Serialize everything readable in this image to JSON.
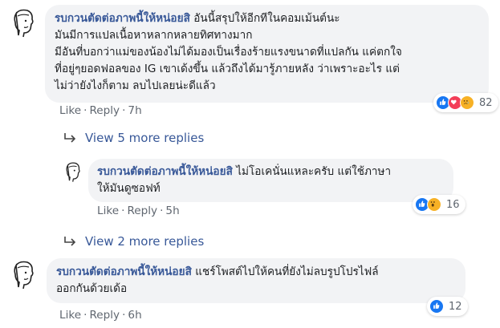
{
  "comments": [
    {
      "author": "รบกวนตัดต่อภาพนี้ให้หน่อยสิ",
      "lines": [
        "อันนี้สรุปให้อีกทีในคอมเม้นต์นะ",
        "มันมีการแปลเนื้อหาหลากหลายทิศทางมาก",
        "มีอันที่บอกว่าแม่ของน้องไม่ได้มองเป็นเรื่องร้ายแรงขนาดที่แปลกัน แค่ตกใจ",
        "ที่อยู่ๆยอดฟอลของ IG เขาเด้งขึ้น แล้วถึงได้มารู้ภายหลัง ว่าเพราะอะไร แต่",
        "ไม่ว่ายังไงก็ตาม ลบไปเลยน่ะดีแล้ว"
      ],
      "like_label": "Like",
      "reply_label": "Reply",
      "time": "7h",
      "reaction_icons": [
        "like-icon",
        "love-icon",
        "sad-icon"
      ],
      "reaction_count": "82"
    },
    {
      "author": "รบกวนตัดต่อภาพนี้ให้หน่อยสิ",
      "lines": [
        "ไม่โอเคนั่นแหละครับ แต่ใช้ภาษา",
        "ให้มันดูซอฟท์"
      ],
      "like_label": "Like",
      "reply_label": "Reply",
      "time": "5h",
      "reaction_icons": [
        "like-icon",
        "wow-icon"
      ],
      "reaction_count": "16"
    },
    {
      "author": "รบกวนตัดต่อภาพนี้ให้หน่อยสิ",
      "lines": [
        "แชร์โพสต์ไปให้คนที่ยังไม่ลบรูปโปรไฟล์",
        "ออกกันด้วยเด้อ"
      ],
      "like_label": "Like",
      "reply_label": "Reply",
      "time": "6h",
      "reaction_icons": [
        "like-icon"
      ],
      "reaction_count": "12"
    }
  ],
  "view_more_1": "View 5 more replies",
  "view_more_2": "View 2 more replies",
  "separator": "·",
  "colors": {
    "link": "#385898",
    "meta": "#606770",
    "bubble": "#f2f3f5",
    "like": "#1877f2",
    "love": "#f33e58",
    "haha": "#f7b125"
  }
}
